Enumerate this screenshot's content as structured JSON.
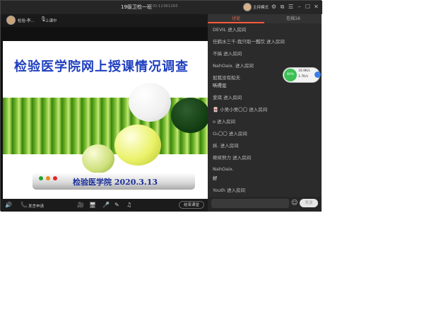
{
  "window": {
    "title": "19级卫检一班",
    "room_id": "ID:11361265",
    "host_mode_label": "主持模式"
  },
  "window_controls": {
    "settings": "⚙",
    "popout": "⧉",
    "menu": "☰",
    "minimize": "–",
    "maximize": "☐",
    "close": "✕"
  },
  "stage": {
    "teacher_name": "检验-李...",
    "status": "上课中",
    "slide": {
      "title": "检验医学院网上授课情况调查",
      "banner": "检验医学院  2020.3.13"
    }
  },
  "toolbar": {
    "speak_request": "发言申请",
    "end_class": "结束课堂"
  },
  "panel": {
    "tabs": [
      {
        "label": "讨论"
      },
      {
        "label": "在线16"
      }
    ],
    "messages": [
      {
        "text": "DEVIL 进入房间"
      },
      {
        "text": "任鹤水三千-我只取一瓢饮 进入房间"
      },
      {
        "text": "不搞 进入房间"
      },
      {
        "text": "NahOaix. 进入房间"
      },
      {
        "text": "如我没有船夫",
        "reply": "听得见"
      },
      {
        "text": "爱琪 进入房间"
      },
      {
        "text": "🀄 小吴小吴〇〇 进入房间"
      },
      {
        "text": "o 进入房间"
      },
      {
        "text": "O₂〇〇 进入房间"
      },
      {
        "text": "妖. 进入房间"
      },
      {
        "text": "继续努力 进入房间"
      },
      {
        "text": "NahOaix.",
        "reply": "好"
      },
      {
        "text": "Youth 进入房间"
      }
    ],
    "input_placeholder": "",
    "send_label": "发送"
  },
  "net_widget": {
    "percent": "80%",
    "upload": "16.9K/s",
    "download": "1.7K/s"
  },
  "colors": {
    "accent": "#ff5a3d",
    "title_blue": "#1f3fbf",
    "net_green": "#3cbf54"
  }
}
